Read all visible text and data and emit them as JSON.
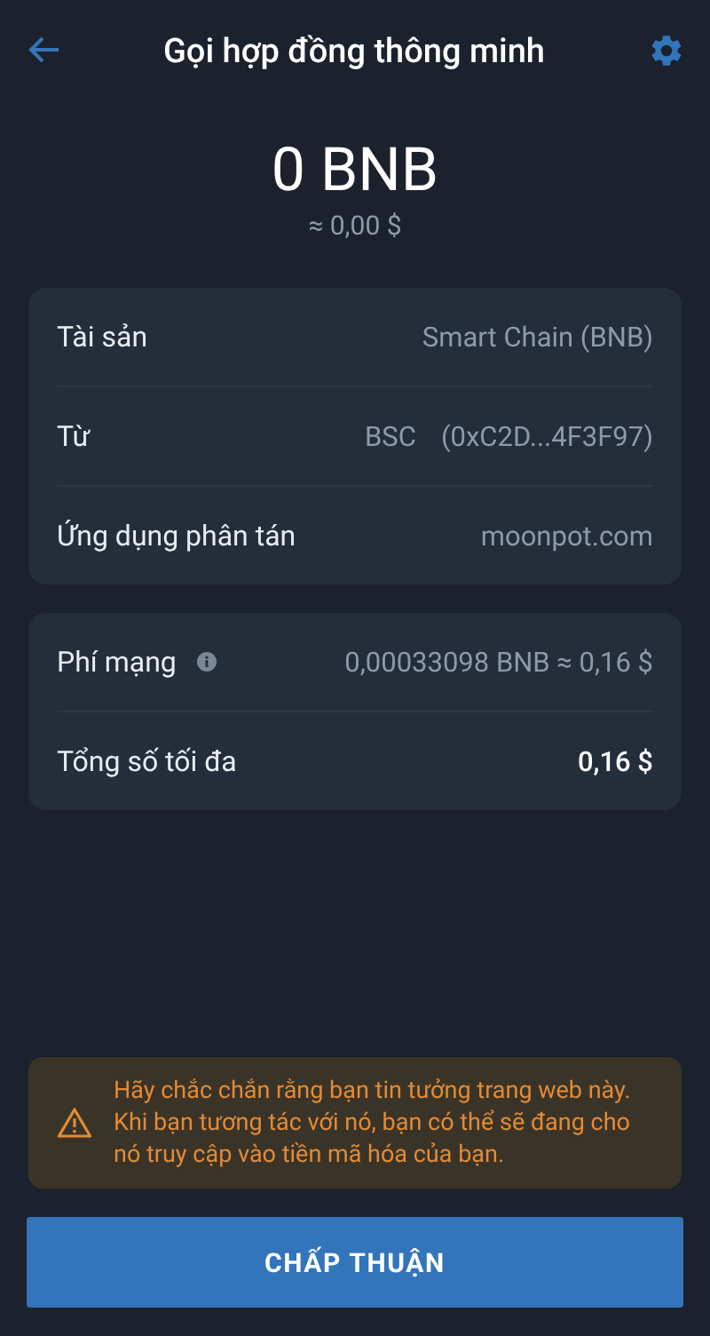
{
  "header": {
    "title": "Gọi hợp đồng thông minh"
  },
  "amount": {
    "value": "0 BNB",
    "fiat": "≈ 0,00 $"
  },
  "details": [
    {
      "label": "Tài sản",
      "values": [
        "Smart Chain (BNB)"
      ],
      "info": false,
      "strong": false
    },
    {
      "label": "Từ",
      "values": [
        "BSC",
        "(0xC2D...4F3F97)"
      ],
      "info": false,
      "strong": false
    },
    {
      "label": "Ứng dụng phân tán",
      "values": [
        "moonpot.com"
      ],
      "info": false,
      "strong": false
    }
  ],
  "fees": [
    {
      "label": "Phí mạng",
      "values": [
        "0,00033098 BNB ≈ 0,16 $"
      ],
      "info": true,
      "strong": false
    },
    {
      "label": "Tổng số tối đa",
      "values": [
        "0,16 $"
      ],
      "info": false,
      "strong": true
    }
  ],
  "warning": {
    "text": "Hãy chắc chắn rằng bạn tin tưởng trang web này. Khi bạn tương tác với nó, bạn có thể sẽ đang cho nó truy cập vào tiền mã hóa của bạn."
  },
  "confirm_button": {
    "label": "CHẤP THUẬN"
  }
}
